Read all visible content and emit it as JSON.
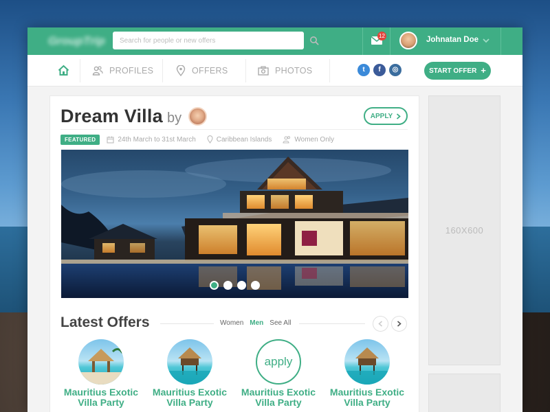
{
  "header": {
    "logo_text": "GroupTrip",
    "search_placeholder": "Search for people or new offers",
    "notification_count": "12",
    "user_name": "Johnatan Doe"
  },
  "nav": {
    "items": [
      {
        "label": "PROFILES",
        "icon": "people-icon"
      },
      {
        "label": "OFFERS",
        "icon": "map-pin-icon"
      },
      {
        "label": "PHOTOS",
        "icon": "camera-icon"
      }
    ],
    "social": [
      {
        "label": "t",
        "icon": "twitter-icon",
        "color": "#3b8ad9"
      },
      {
        "label": "f",
        "icon": "facebook-icon",
        "color": "#3b5b99"
      },
      {
        "label": "◎",
        "icon": "instagram-icon",
        "color": "#3b6d9e"
      }
    ],
    "start_offer_label": "START OFFER"
  },
  "offer": {
    "title": "Dream Villa",
    "by_label": "by",
    "apply_label": "APPLY",
    "badge": "FEATURED",
    "dates": "24th March to 31st March",
    "location": "Caribbean Islands",
    "audience": "Women Only",
    "carousel_active": 1,
    "carousel_total": 4
  },
  "latest": {
    "title": "Latest Offers",
    "filters": [
      "Women",
      "Men",
      "See All"
    ],
    "active_filter": "Men",
    "items": [
      {
        "name": "Mauritius Exotic Villa Party"
      },
      {
        "name": "Mauritius Exotic Villa Party"
      },
      {
        "name": "Mauritius Exotic Villa Party",
        "apply": "apply"
      },
      {
        "name": "Mauritius Exotic Villa Party"
      }
    ]
  },
  "ad": {
    "label": "160X600"
  },
  "colors": {
    "accent": "#3fae85",
    "badge": "#e2453c"
  }
}
